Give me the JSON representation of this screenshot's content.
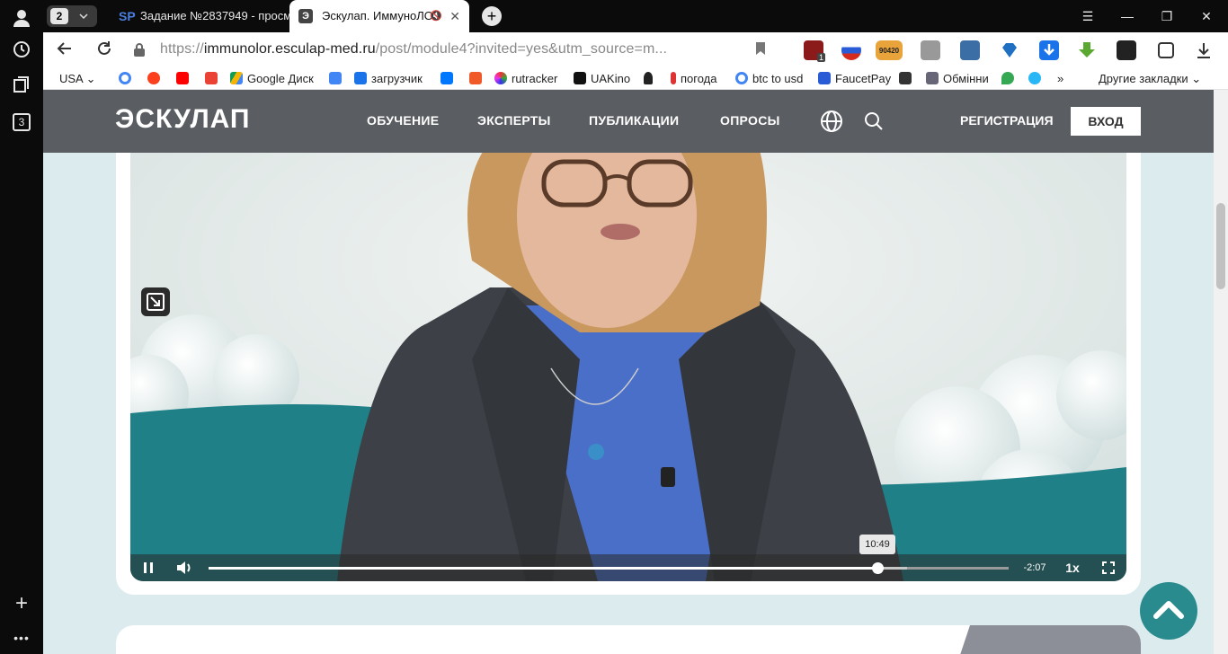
{
  "browser": {
    "tab_count": "2",
    "tabs": [
      {
        "favicon": "SP",
        "title": "Задание №2837949 - просм"
      },
      {
        "favicon": "Э",
        "title": "Эскулап. ИммуноЛОР"
      }
    ],
    "url_domain": "immunolor.esculap-med.ru",
    "url_scheme": "https://",
    "url_path": "/post/module4?invited=yes&utm_source=m...",
    "sidebar_badge": "3"
  },
  "bookmarks": {
    "region": "USA",
    "items": [
      "Google Диск",
      "загрузчик",
      "rutracker",
      "UAKino",
      "погода",
      "btc to usd",
      "FaucetPay",
      "Обмінни"
    ],
    "more": "»",
    "other": "Другие закладки"
  },
  "extensions": {
    "badge_count": "1",
    "price_badge": "90420"
  },
  "site": {
    "logo": "ЭСКУЛАП",
    "nav": [
      "ОБУЧЕНИЕ",
      "ЭКСПЕРТЫ",
      "ПУБЛИКАЦИИ",
      "ОПРОСЫ"
    ],
    "register": "РЕГИСТРАЦИЯ",
    "login": "ВХОД"
  },
  "player": {
    "hover_time": "10:49",
    "remaining": "-2:07",
    "speed": "1x",
    "progress": 0.836,
    "buffered": 0.873
  },
  "colors": {
    "header": "#5a5d61",
    "page_bg": "#dcecee",
    "accent_teal": "#2a8b8f",
    "wave_teal": "#1f8087"
  }
}
